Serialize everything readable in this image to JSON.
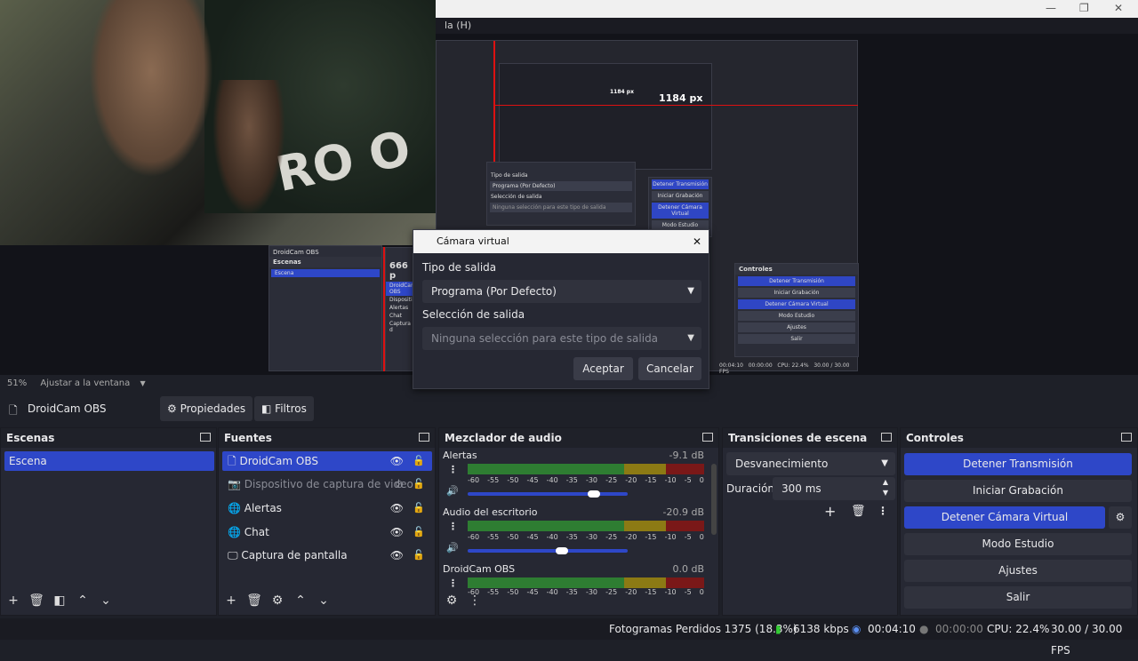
{
  "menubar": {
    "text": "la (H)"
  },
  "nested": {
    "px_label": "1184 px",
    "px_label_small": "1184 px",
    "panel_label": "666 p"
  },
  "preview": {
    "zoom": "51%",
    "fit": "Ajustar a la ventana",
    "flag_text": "RO O"
  },
  "source_bar": {
    "name": "DroidCam OBS",
    "props": "Propiedades",
    "filters": "Filtros"
  },
  "scenes": {
    "title": "Escenas",
    "items": [
      "Escena"
    ]
  },
  "sources": {
    "title": "Fuentes",
    "items": [
      {
        "name": "DroidCam OBS"
      },
      {
        "name": "Dispositivo de captura de video"
      },
      {
        "name": "Alertas"
      },
      {
        "name": "Chat"
      },
      {
        "name": "Captura de pantalla"
      }
    ]
  },
  "mixer": {
    "title": "Mezclador de audio",
    "channels": [
      {
        "name": "Alertas",
        "db": "-9.1 dB",
        "volume": 0.75
      },
      {
        "name": "Audio del escritorio",
        "db": "-20.9 dB",
        "volume": 0.55
      },
      {
        "name": "DroidCam OBS",
        "db": "0.0 dB"
      }
    ],
    "scale": [
      "-60",
      "-55",
      "-50",
      "-45",
      "-40",
      "-35",
      "-30",
      "-25",
      "-20",
      "-15",
      "-10",
      "-5",
      "0"
    ]
  },
  "transitions": {
    "title": "Transiciones de escena",
    "type": "Desvanecimiento",
    "duration_label": "Duración",
    "duration": "300 ms"
  },
  "controls": {
    "title": "Controles",
    "stream": "Detener Transmisión",
    "record": "Iniciar Grabación",
    "vcam": "Detener Cámara Virtual",
    "studio": "Modo Estudio",
    "settings": "Ajustes",
    "exit": "Salir"
  },
  "dialog": {
    "title": "Cámara virtual",
    "output_type_label": "Tipo de salida",
    "output_type": "Programa (Por Defecto)",
    "selection_label": "Selección de salida",
    "selection_placeholder": "Ninguna selección para este tipo de salida",
    "ok": "Aceptar",
    "cancel": "Cancelar"
  },
  "status": {
    "dropped": "Fotogramas Perdidos 1375 (18.3%)",
    "kbps": "6138 kbps",
    "stream_time": "00:04:10",
    "rec_time": "00:00:00",
    "cpu": "CPU: 22.4%",
    "fps": "30.00 / 30.00 FPS"
  },
  "mini": {
    "tipo": "Tipo de salida",
    "programa": "Programa (Por Defecto)",
    "seleccion": "Selección de salida",
    "ninguna": "Ninguna selección para este tipo de salida",
    "escenas": "Escenas",
    "escena": "Escena",
    "droidcam": "DroidCam OBS",
    "propiedades": "Propiedades",
    "controles": "Controles",
    "detener_tx": "Detener Transmisión",
    "iniciar_grab": "Iniciar Grabación",
    "detener_cam": "Detener Cámara Virtual",
    "modo": "Modo Estudio",
    "ajustes": "Ajustes",
    "salir": "Salir",
    "dispositivo": "Dispositivo",
    "alertas": "Alertas",
    "chat": "Chat",
    "captura": "Captura d",
    "cpu": "CPU: 22.4%",
    "fps": "30.00 / 30.00 FPS",
    "time": "00:04:10",
    "rec": "00:00:00"
  }
}
